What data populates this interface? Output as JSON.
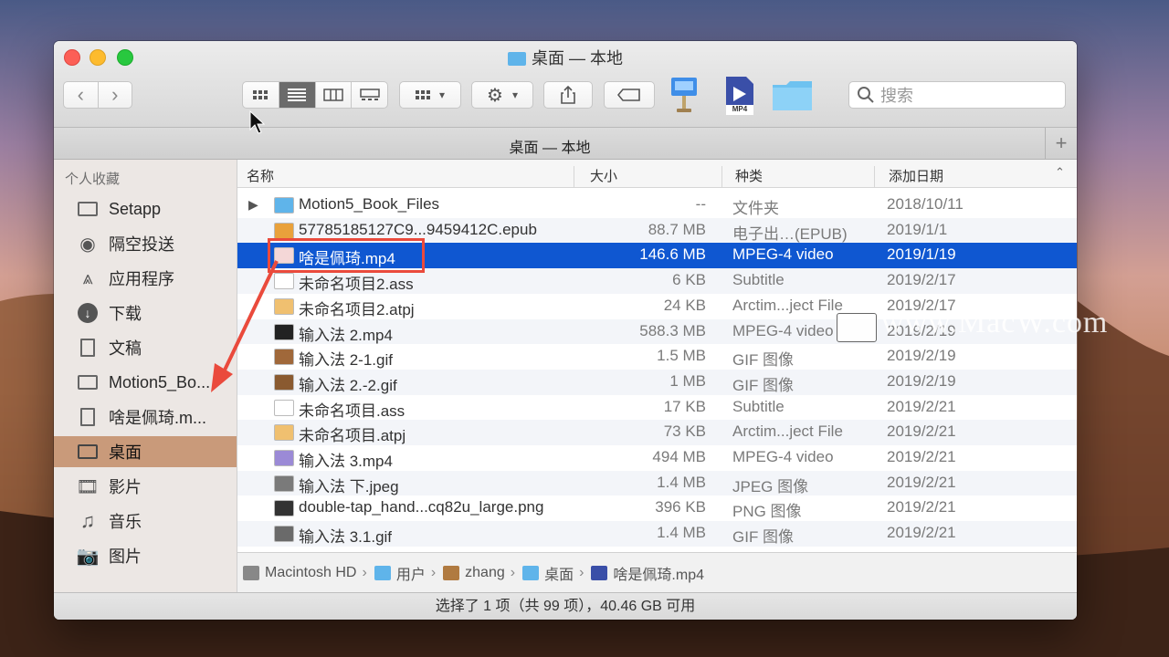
{
  "window": {
    "title": "桌面 — 本地",
    "tab_title": "桌面 — 本地",
    "search_placeholder": "搜索",
    "status": "选择了 1 项（共 99 项），40.46 GB 可用"
  },
  "sidebar": {
    "section": "个人收藏",
    "items": [
      {
        "label": "Setapp",
        "icon": "folder-icon"
      },
      {
        "label": "隔空投送",
        "icon": "airdrop-icon"
      },
      {
        "label": "应用程序",
        "icon": "applications-icon"
      },
      {
        "label": "下载",
        "icon": "download-icon"
      },
      {
        "label": "文稿",
        "icon": "documents-icon"
      },
      {
        "label": "Motion5_Bo...",
        "icon": "folder-icon"
      },
      {
        "label": "啥是佩琦.m...",
        "icon": "file-icon"
      },
      {
        "label": "桌面",
        "icon": "desktop-icon",
        "selected": true
      },
      {
        "label": "影片",
        "icon": "movies-icon"
      },
      {
        "label": "音乐",
        "icon": "music-icon"
      },
      {
        "label": "图片",
        "icon": "pictures-icon"
      }
    ]
  },
  "columns": {
    "name": "名称",
    "size": "大小",
    "kind": "种类",
    "date": "添加日期"
  },
  "files": [
    {
      "name": "Motion5_Book_Files",
      "size": "--",
      "kind": "文件夹",
      "date": "2018/10/11",
      "icon": "folder-icon",
      "color": "#5fb4ea",
      "disclosure": true
    },
    {
      "name": "57785185127C9...9459412C.epub",
      "size": "88.7 MB",
      "kind": "电子出…(EPUB)",
      "date": "2019/1/1",
      "icon": "epub-icon",
      "color": "#e9a13b"
    },
    {
      "name": "啥是佩琦.mp4",
      "size": "146.6 MB",
      "kind": "MPEG-4 video",
      "date": "2019/1/19",
      "icon": "video-icon",
      "color": "#f4d7d7",
      "selected": true
    },
    {
      "name": "未命名项目2.ass",
      "size": "6 KB",
      "kind": "Subtitle",
      "date": "2019/2/17",
      "icon": "doc-icon",
      "color": "#ffffff"
    },
    {
      "name": "未命名项目2.atpj",
      "size": "24 KB",
      "kind": "Arctim...ject File",
      "date": "2019/2/17",
      "icon": "project-icon",
      "color": "#f0c070"
    },
    {
      "name": "输入法 2.mp4",
      "size": "588.3 MB",
      "kind": "MPEG-4 video",
      "date": "2019/2/19",
      "icon": "video-icon",
      "color": "#222222"
    },
    {
      "name": "输入法 2-1.gif",
      "size": "1.5 MB",
      "kind": "GIF 图像",
      "date": "2019/2/19",
      "icon": "image-icon",
      "color": "#a0683a"
    },
    {
      "name": "输入法 2.-2.gif",
      "size": "1 MB",
      "kind": "GIF 图像",
      "date": "2019/2/19",
      "icon": "image-icon",
      "color": "#8a5a30"
    },
    {
      "name": "未命名项目.ass",
      "size": "17 KB",
      "kind": "Subtitle",
      "date": "2019/2/21",
      "icon": "doc-icon",
      "color": "#ffffff"
    },
    {
      "name": "未命名项目.atpj",
      "size": "73 KB",
      "kind": "Arctim...ject File",
      "date": "2019/2/21",
      "icon": "project-icon",
      "color": "#f0c070"
    },
    {
      "name": "输入法 3.mp4",
      "size": "494 MB",
      "kind": "MPEG-4 video",
      "date": "2019/2/21",
      "icon": "video-icon",
      "color": "#9b8ad6"
    },
    {
      "name": "输入法 下.jpeg",
      "size": "1.4 MB",
      "kind": "JPEG 图像",
      "date": "2019/2/21",
      "icon": "image-icon",
      "color": "#7a7a7a"
    },
    {
      "name": "double-tap_hand...cq82u_large.png",
      "size": "396 KB",
      "kind": "PNG 图像",
      "date": "2019/2/21",
      "icon": "image-icon",
      "color": "#333333"
    },
    {
      "name": "输入法 3.1.gif",
      "size": "1.4 MB",
      "kind": "GIF 图像",
      "date": "2019/2/21",
      "icon": "image-icon",
      "color": "#6a6a6a"
    }
  ],
  "path": [
    {
      "label": "Macintosh HD",
      "icon": "disk-icon",
      "color": "#888888"
    },
    {
      "label": "用户",
      "icon": "folder-icon",
      "color": "#5fb4ea"
    },
    {
      "label": "zhang",
      "icon": "home-icon",
      "color": "#b07a40"
    },
    {
      "label": "桌面",
      "icon": "folder-icon",
      "color": "#5fb4ea"
    },
    {
      "label": "啥是佩琦.mp4",
      "icon": "video-icon",
      "color": "#3a4fa8"
    }
  ],
  "toolbar_app_labels": {
    "mp4": "MP4"
  },
  "watermark": "www.MacW.com"
}
